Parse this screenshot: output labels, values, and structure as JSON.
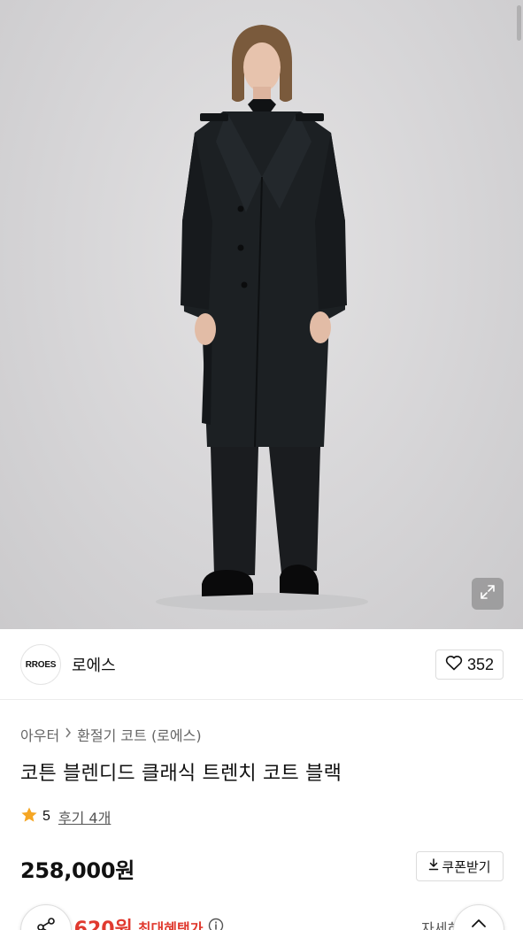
{
  "brand": {
    "logo_text": "RROES",
    "name": "로에스",
    "like_count": "352"
  },
  "breadcrumb": {
    "category": "아우터",
    "subcategory": "환절기 코트 (로에스)"
  },
  "product": {
    "title": "코튼 블렌디드 클래식 트렌치 코트 블랙",
    "rating": "5",
    "reviews_label": "후기 4개",
    "price": "258,000원",
    "coupon_label": "쿠폰받기"
  },
  "benefit": {
    "amount": "0,620원",
    "label": "최대혜택가",
    "detail_label": "자세히"
  },
  "icons": {
    "expand": "expand-icon",
    "heart": "heart-icon",
    "star": "star-icon",
    "download": "download-icon",
    "share": "share-icon",
    "chevron_up": "chevron-up-icon",
    "info": "info-icon",
    "breadcrumb_separator": "chevron-right-icon"
  },
  "colors": {
    "star": "#f5a623",
    "benefit": "#e03a2f",
    "coat": "#1c2023"
  }
}
